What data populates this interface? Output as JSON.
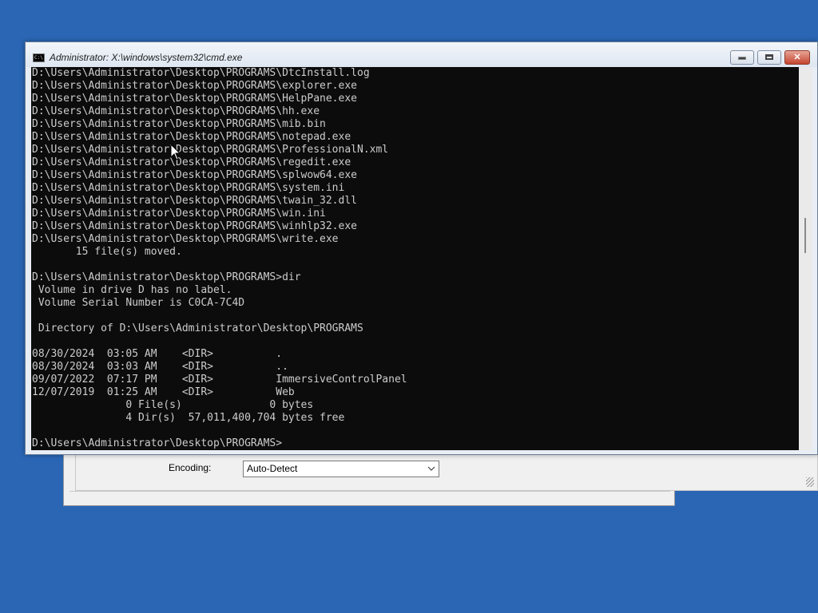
{
  "desktop": {
    "background_color": "#2b66b4"
  },
  "background_dialog": {
    "encoding_label": "Encoding:",
    "encoding_value": "Auto-Detect"
  },
  "cmd_window": {
    "title": "Administrator: X:\\windows\\system32\\cmd.exe",
    "icon_label": "C:\\",
    "buttons": {
      "minimize": "minimize-icon",
      "maximize": "maximize-icon",
      "close": "✕"
    },
    "lines": [
      "D:\\Users\\Administrator\\Desktop\\PROGRAMS\\DtcInstall.log",
      "D:\\Users\\Administrator\\Desktop\\PROGRAMS\\explorer.exe",
      "D:\\Users\\Administrator\\Desktop\\PROGRAMS\\HelpPane.exe",
      "D:\\Users\\Administrator\\Desktop\\PROGRAMS\\hh.exe",
      "D:\\Users\\Administrator\\Desktop\\PROGRAMS\\mib.bin",
      "D:\\Users\\Administrator\\Desktop\\PROGRAMS\\notepad.exe",
      "D:\\Users\\Administrator\\Desktop\\PROGRAMS\\ProfessionalN.xml",
      "D:\\Users\\Administrator\\Desktop\\PROGRAMS\\regedit.exe",
      "D:\\Users\\Administrator\\Desktop\\PROGRAMS\\splwow64.exe",
      "D:\\Users\\Administrator\\Desktop\\PROGRAMS\\system.ini",
      "D:\\Users\\Administrator\\Desktop\\PROGRAMS\\twain_32.dll",
      "D:\\Users\\Administrator\\Desktop\\PROGRAMS\\win.ini",
      "D:\\Users\\Administrator\\Desktop\\PROGRAMS\\winhlp32.exe",
      "D:\\Users\\Administrator\\Desktop\\PROGRAMS\\write.exe",
      "       15 file(s) moved.",
      "",
      "D:\\Users\\Administrator\\Desktop\\PROGRAMS>dir",
      " Volume in drive D has no label.",
      " Volume Serial Number is C0CA-7C4D",
      "",
      " Directory of D:\\Users\\Administrator\\Desktop\\PROGRAMS",
      "",
      "08/30/2024  03:05 AM    <DIR>          .",
      "08/30/2024  03:03 AM    <DIR>          ..",
      "09/07/2022  07:17 PM    <DIR>          ImmersiveControlPanel",
      "12/07/2019  01:25 AM    <DIR>          Web",
      "               0 File(s)              0 bytes",
      "               4 Dir(s)  57,011,400,704 bytes free",
      "",
      "D:\\Users\\Administrator\\Desktop\\PROGRAMS>"
    ]
  }
}
